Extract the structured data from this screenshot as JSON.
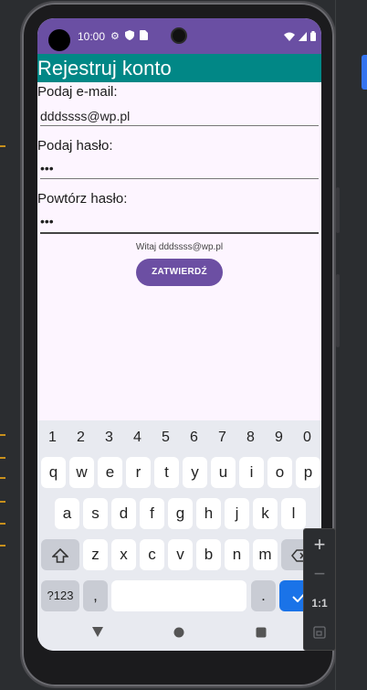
{
  "status_bar": {
    "time": "10:00"
  },
  "app_bar": {
    "title": "Rejestruj konto"
  },
  "form": {
    "email_label": "Podaj e-mail:",
    "email_value": "dddssss@wp.pl",
    "password_label": "Podaj hasło:",
    "password_value": "•••",
    "repeat_label": "Powtórz hasło:",
    "repeat_value": "•••",
    "greeting": "Witaj dddssss@wp.pl",
    "submit_label": "ZATWIERDŹ"
  },
  "keyboard": {
    "numbers": [
      "1",
      "2",
      "3",
      "4",
      "5",
      "6",
      "7",
      "8",
      "9",
      "0"
    ],
    "row1": [
      "q",
      "w",
      "e",
      "r",
      "t",
      "y",
      "u",
      "i",
      "o",
      "p"
    ],
    "row2": [
      "a",
      "s",
      "d",
      "f",
      "g",
      "h",
      "j",
      "k",
      "l"
    ],
    "row3": [
      "z",
      "x",
      "c",
      "v",
      "b",
      "n",
      "m"
    ],
    "symbols_label": "?123",
    "comma_label": ",",
    "period_label": "."
  },
  "zoom_panel": {
    "zoom_in": "+",
    "zoom_out": "−",
    "actual_size": "1:1"
  },
  "colors": {
    "status_bar": "#6a4fa3",
    "app_bar": "#018786",
    "button": "#6c4fa3",
    "screen_bg": "#fdf5ff",
    "enter_key": "#1a73e8"
  },
  "icons": [
    "settings-icon",
    "shield-icon",
    "sim-icon",
    "wifi-icon",
    "signal-icon",
    "battery-icon",
    "shift-icon",
    "backspace-icon",
    "check-icon",
    "back-icon",
    "home-icon",
    "recents-icon"
  ]
}
